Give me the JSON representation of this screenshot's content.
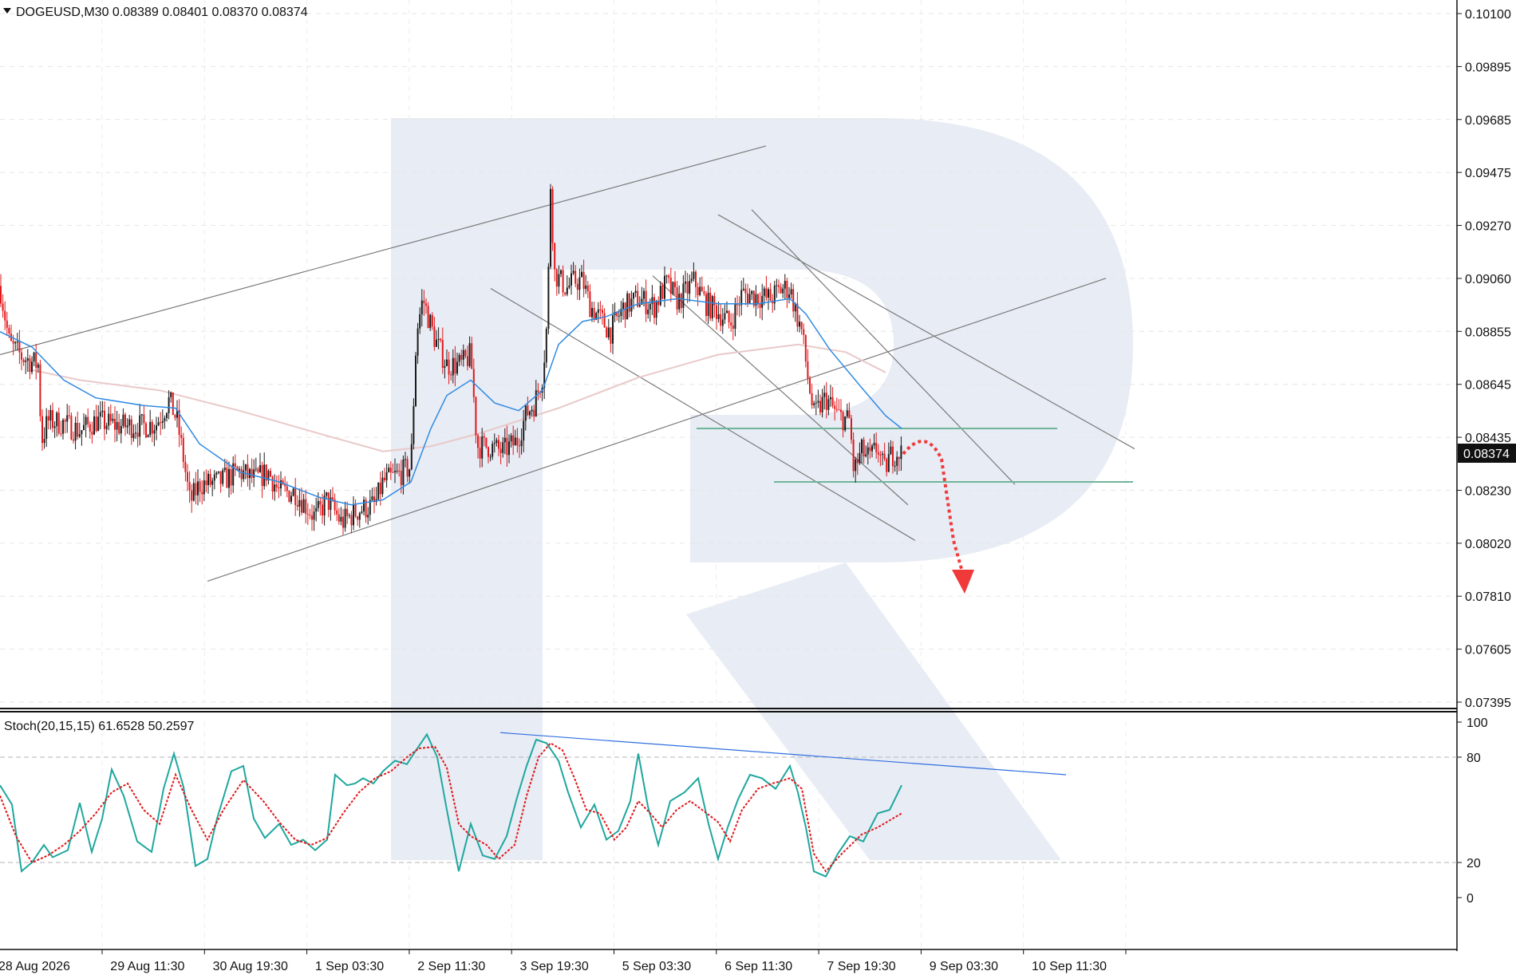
{
  "header": {
    "symbol_line": "DOGEUSD,M30  0.08389 0.08401 0.08370 0.08374",
    "stoch_line": "Stoch(20,15,15) 61.6528 50.2597"
  },
  "current_price_label": "0.08374",
  "colors": {
    "bull_candle": "#1a1a1a",
    "bear_candle": "#e0191c",
    "fast_ma": "#2f8ae3",
    "slow_ma": "#e9c9c9",
    "stoch_main": "#1fa79e",
    "stoch_signal": "#e0191c",
    "trendline": "#7a7a7a",
    "level_line": "#6fb59a",
    "stoch_trendline": "#2f6ee0",
    "forecast_arrow": "#f03a3a",
    "watermark": "#e8ecf4"
  },
  "chart_data": [
    {
      "type": "candlestick",
      "title": "DOGEUSD,M30",
      "ohlc_last": {
        "open": 0.08389,
        "high": 0.08401,
        "low": 0.0837,
        "close": 0.08374
      },
      "y_ticks": [
        "0.10100",
        "0.09895",
        "0.09685",
        "0.09475",
        "0.09270",
        "0.09060",
        "0.08855",
        "0.08645",
        "0.08435",
        "0.08230",
        "0.08020",
        "0.07810",
        "0.07605",
        "0.07395"
      ],
      "ylim": [
        0.07395,
        0.101
      ],
      "x_ticks": [
        "28 Aug 2026",
        "29 Aug 11:30",
        "30 Aug 19:30",
        "1 Sep 03:30",
        "2 Sep 11:30",
        "3 Sep 19:30",
        "5 Sep 03:30",
        "6 Sep 11:30",
        "7 Sep 19:30",
        "9 Sep 03:30",
        "10 Sep 11:30"
      ],
      "price_path": [
        [
          0,
          0.0903
        ],
        [
          12,
          0.088
        ],
        [
          28,
          0.0875
        ],
        [
          48,
          0.0872
        ],
        [
          52,
          0.0842
        ],
        [
          60,
          0.085
        ],
        [
          80,
          0.0849
        ],
        [
          100,
          0.0846
        ],
        [
          120,
          0.085
        ],
        [
          150,
          0.0848
        ],
        [
          180,
          0.0848
        ],
        [
          196,
          0.0849
        ],
        [
          212,
          0.0858
        ],
        [
          222,
          0.085
        ],
        [
          230,
          0.0835
        ],
        [
          238,
          0.0818
        ],
        [
          250,
          0.0825
        ],
        [
          275,
          0.0826
        ],
        [
          300,
          0.083
        ],
        [
          320,
          0.0827
        ],
        [
          336,
          0.083
        ],
        [
          350,
          0.0822
        ],
        [
          370,
          0.0822
        ],
        [
          395,
          0.0812
        ],
        [
          410,
          0.0819
        ],
        [
          428,
          0.081
        ],
        [
          450,
          0.0815
        ],
        [
          470,
          0.0817
        ],
        [
          480,
          0.0826
        ],
        [
          500,
          0.0829
        ],
        [
          515,
          0.0832
        ],
        [
          522,
          0.0885
        ],
        [
          530,
          0.0898
        ],
        [
          545,
          0.0882
        ],
        [
          560,
          0.0872
        ],
        [
          578,
          0.0872
        ],
        [
          590,
          0.0876
        ],
        [
          598,
          0.084
        ],
        [
          612,
          0.084
        ],
        [
          630,
          0.0838
        ],
        [
          648,
          0.0842
        ],
        [
          660,
          0.0853
        ],
        [
          670,
          0.0857
        ],
        [
          680,
          0.0868
        ],
        [
          686,
          0.089
        ],
        [
          690,
          0.0943
        ],
        [
          695,
          0.0908
        ],
        [
          710,
          0.0902
        ],
        [
          720,
          0.0905
        ],
        [
          730,
          0.0905
        ],
        [
          740,
          0.0895
        ],
        [
          755,
          0.0889
        ],
        [
          765,
          0.0885
        ],
        [
          780,
          0.0894
        ],
        [
          800,
          0.0898
        ],
        [
          820,
          0.0895
        ],
        [
          835,
          0.0904
        ],
        [
          850,
          0.0897
        ],
        [
          870,
          0.0905
        ],
        [
          885,
          0.0896
        ],
        [
          900,
          0.0893
        ],
        [
          915,
          0.0888
        ],
        [
          930,
          0.09
        ],
        [
          950,
          0.0899
        ],
        [
          965,
          0.0898
        ],
        [
          980,
          0.0902
        ],
        [
          990,
          0.0902
        ],
        [
          998,
          0.0892
        ],
        [
          1005,
          0.0885
        ],
        [
          1012,
          0.0868
        ],
        [
          1020,
          0.0852
        ],
        [
          1035,
          0.0859
        ],
        [
          1050,
          0.0852
        ],
        [
          1065,
          0.085
        ],
        [
          1070,
          0.083
        ],
        [
          1080,
          0.0838
        ],
        [
          1090,
          0.0835
        ],
        [
          1100,
          0.084
        ],
        [
          1108,
          0.083
        ],
        [
          1115,
          0.0836
        ],
        [
          1125,
          0.0838
        ],
        [
          1132,
          0.0837
        ]
      ],
      "fast_ma_path": [
        [
          0,
          0.0885
        ],
        [
          40,
          0.0879
        ],
        [
          80,
          0.0866
        ],
        [
          120,
          0.0859
        ],
        [
          180,
          0.0856
        ],
        [
          220,
          0.0855
        ],
        [
          250,
          0.0841
        ],
        [
          300,
          0.083
        ],
        [
          350,
          0.0826
        ],
        [
          400,
          0.082
        ],
        [
          440,
          0.0817
        ],
        [
          480,
          0.0819
        ],
        [
          515,
          0.0826
        ],
        [
          540,
          0.0847
        ],
        [
          560,
          0.086
        ],
        [
          590,
          0.0866
        ],
        [
          620,
          0.0857
        ],
        [
          650,
          0.0854
        ],
        [
          680,
          0.0862
        ],
        [
          700,
          0.088
        ],
        [
          730,
          0.0889
        ],
        [
          760,
          0.0891
        ],
        [
          800,
          0.0896
        ],
        [
          850,
          0.0898
        ],
        [
          900,
          0.0896
        ],
        [
          950,
          0.0896
        ],
        [
          990,
          0.0898
        ],
        [
          1010,
          0.0892
        ],
        [
          1040,
          0.0878
        ],
        [
          1080,
          0.0863
        ],
        [
          1110,
          0.0852
        ],
        [
          1130,
          0.0847
        ]
      ],
      "slow_ma_path": [
        [
          40,
          0.087
        ],
        [
          100,
          0.0866
        ],
        [
          200,
          0.0862
        ],
        [
          300,
          0.0854
        ],
        [
          400,
          0.0845
        ],
        [
          480,
          0.0838
        ],
        [
          540,
          0.084
        ],
        [
          600,
          0.0845
        ],
        [
          700,
          0.0855
        ],
        [
          800,
          0.0867
        ],
        [
          900,
          0.0876
        ],
        [
          1000,
          0.088
        ],
        [
          1060,
          0.0877
        ],
        [
          1110,
          0.0869
        ]
      ],
      "trendlines": [
        [
          [
            0,
            0.0876
          ],
          [
            960,
            0.0958
          ]
        ],
        [
          [
            260,
            0.0787
          ],
          [
            1386,
            0.0906
          ]
        ],
        [
          [
            615,
            0.0902
          ],
          [
            1147,
            0.0803
          ]
        ],
        [
          [
            818,
            0.0907
          ],
          [
            1138,
            0.0817
          ]
        ],
        [
          [
            900,
            0.0931
          ],
          [
            1422,
            0.0839
          ]
        ],
        [
          [
            942,
            0.0933
          ],
          [
            1272,
            0.0825
          ]
        ]
      ],
      "levels": [
        {
          "price": 0.0847,
          "from": 873,
          "to": 1325
        },
        {
          "price": 0.0826,
          "from": 970,
          "to": 1420
        }
      ],
      "forecast": [
        [
          1132,
          0.0837
        ],
        [
          1160,
          0.0846
        ],
        [
          1180,
          0.0835
        ],
        [
          1195,
          0.0803
        ],
        [
          1207,
          0.0784
        ]
      ]
    },
    {
      "type": "line",
      "title": "Stoch(20,15,15)",
      "last_values": {
        "main": 61.6528,
        "signal": 50.2597
      },
      "y_ticks": [
        "100",
        "80",
        "20",
        "0"
      ],
      "ylim": [
        0,
        100
      ],
      "levels": [
        80,
        20
      ],
      "series": [
        {
          "name": "main",
          "values": [
            [
              0,
              64
            ],
            [
              15,
              53
            ],
            [
              27,
              15
            ],
            [
              40,
              20
            ],
            [
              55,
              30
            ],
            [
              66,
              23
            ],
            [
              85,
              27
            ],
            [
              100,
              54
            ],
            [
              115,
              26
            ],
            [
              128,
              45
            ],
            [
              140,
              73
            ],
            [
              155,
              58
            ],
            [
              172,
              32
            ],
            [
              190,
              26
            ],
            [
              205,
              62
            ],
            [
              218,
              82
            ],
            [
              230,
              63
            ],
            [
              245,
              18
            ],
            [
              260,
              22
            ],
            [
              272,
              45
            ],
            [
              290,
              72
            ],
            [
              305,
              75
            ],
            [
              318,
              45
            ],
            [
              332,
              34
            ],
            [
              350,
              42
            ],
            [
              365,
              30
            ],
            [
              380,
              33
            ],
            [
              395,
              27
            ],
            [
              410,
              33
            ],
            [
              420,
              70
            ],
            [
              435,
              64
            ],
            [
              445,
              65
            ],
            [
              455,
              68
            ],
            [
              468,
              65
            ],
            [
              480,
              72
            ],
            [
              495,
              78
            ],
            [
              510,
              76
            ],
            [
              520,
              83
            ],
            [
              535,
              93
            ],
            [
              548,
              80
            ],
            [
              560,
              50
            ],
            [
              575,
              15
            ],
            [
              590,
              42
            ],
            [
              605,
              24
            ],
            [
              620,
              22
            ],
            [
              635,
              35
            ],
            [
              648,
              57
            ],
            [
              660,
              75
            ],
            [
              672,
              90
            ],
            [
              685,
              88
            ],
            [
              700,
              78
            ],
            [
              712,
              60
            ],
            [
              728,
              40
            ],
            [
              745,
              53
            ],
            [
              760,
              33
            ],
            [
              775,
              38
            ],
            [
              790,
              55
            ],
            [
              800,
              82
            ],
            [
              812,
              52
            ],
            [
              825,
              30
            ],
            [
              840,
              55
            ],
            [
              858,
              60
            ],
            [
              875,
              68
            ],
            [
              888,
              42
            ],
            [
              900,
              22
            ],
            [
              912,
              40
            ],
            [
              925,
              56
            ],
            [
              940,
              70
            ],
            [
              955,
              68
            ],
            [
              972,
              62
            ],
            [
              990,
              75
            ],
            [
              1000,
              60
            ],
            [
              1010,
              40
            ],
            [
              1020,
              15
            ],
            [
              1035,
              12
            ],
            [
              1050,
              25
            ],
            [
              1065,
              35
            ],
            [
              1082,
              32
            ],
            [
              1100,
              48
            ],
            [
              1115,
              50
            ],
            [
              1130,
              64
            ]
          ]
        },
        {
          "name": "signal",
          "values": [
            [
              0,
              58
            ],
            [
              20,
              35
            ],
            [
              40,
              20
            ],
            [
              60,
              24
            ],
            [
              80,
              30
            ],
            [
              100,
              38
            ],
            [
              120,
              48
            ],
            [
              140,
              60
            ],
            [
              160,
              65
            ],
            [
              180,
              50
            ],
            [
              200,
              42
            ],
            [
              220,
              70
            ],
            [
              240,
              50
            ],
            [
              260,
              33
            ],
            [
              280,
              50
            ],
            [
              305,
              67
            ],
            [
              330,
              55
            ],
            [
              350,
              43
            ],
            [
              370,
              33
            ],
            [
              390,
              30
            ],
            [
              410,
              34
            ],
            [
              430,
              48
            ],
            [
              450,
              60
            ],
            [
              470,
              68
            ],
            [
              490,
              72
            ],
            [
              510,
              80
            ],
            [
              525,
              85
            ],
            [
              545,
              86
            ],
            [
              560,
              74
            ],
            [
              575,
              42
            ],
            [
              590,
              35
            ],
            [
              610,
              30
            ],
            [
              625,
              22
            ],
            [
              645,
              30
            ],
            [
              660,
              58
            ],
            [
              675,
              80
            ],
            [
              690,
              88
            ],
            [
              705,
              84
            ],
            [
              720,
              68
            ],
            [
              735,
              50
            ],
            [
              752,
              48
            ],
            [
              770,
              33
            ],
            [
              785,
              40
            ],
            [
              800,
              55
            ],
            [
              815,
              48
            ],
            [
              830,
              40
            ],
            [
              848,
              50
            ],
            [
              865,
              55
            ],
            [
              880,
              50
            ],
            [
              900,
              43
            ],
            [
              915,
              32
            ],
            [
              930,
              50
            ],
            [
              950,
              62
            ],
            [
              968,
              65
            ],
            [
              990,
              68
            ],
            [
              1005,
              62
            ],
            [
              1020,
              25
            ],
            [
              1035,
              15
            ],
            [
              1055,
              25
            ],
            [
              1080,
              36
            ],
            [
              1100,
              40
            ],
            [
              1130,
              48
            ]
          ]
        }
      ],
      "trendline": [
        [
          627,
          94
        ],
        [
          1336,
          70
        ]
      ]
    }
  ]
}
